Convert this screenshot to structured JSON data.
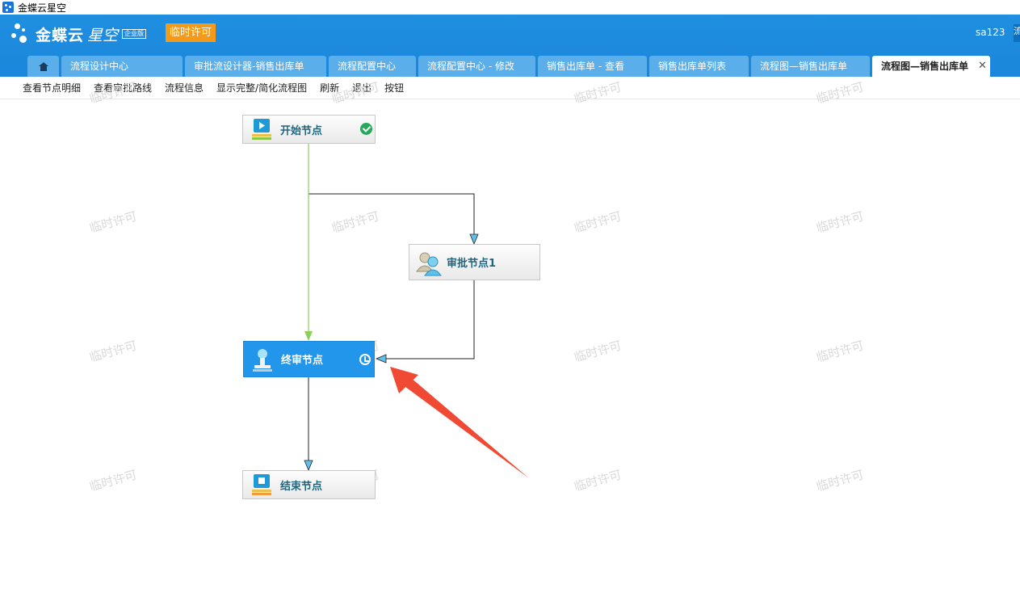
{
  "window": {
    "title": "金蝶云星空"
  },
  "header": {
    "brand": "金蝶云",
    "brand_sub": "星空",
    "edition": "企业版",
    "license_badge": "临时许可",
    "user": "sa123",
    "user_extra": "流"
  },
  "tabs": [
    {
      "label": "流程设计中心"
    },
    {
      "label": "审批流设计器-销售出库单"
    },
    {
      "label": "流程配置中心"
    },
    {
      "label": "流程配置中心 - 修改"
    },
    {
      "label": "销售出库单 - 查看"
    },
    {
      "label": "销售出库单列表"
    },
    {
      "label": "流程图—销售出库单"
    },
    {
      "label": "流程图—销售出库单",
      "active": true
    }
  ],
  "toolbar": {
    "items": [
      "查看节点明细",
      "查看审批路线",
      "流程信息",
      "显示完整/简化流程图",
      "刷新",
      "退出",
      "按钮"
    ]
  },
  "flow": {
    "nodes": {
      "start": {
        "label": "开始节点",
        "status": "completed"
      },
      "approve1": {
        "label": "审批节点1"
      },
      "final": {
        "label": "终审节点",
        "status": "in-progress",
        "selected": true
      },
      "end": {
        "label": "结束节点"
      }
    }
  },
  "watermark_text": "临时许可",
  "colors": {
    "header_blue": "#1b86db",
    "tab_blue": "#5aaeea",
    "license_orange": "#f39a1b",
    "selected_node": "#2196eb",
    "active_path_green": "#8ccf5a",
    "annotation_arrow": "#f04a34",
    "check_green": "#27a75c"
  }
}
